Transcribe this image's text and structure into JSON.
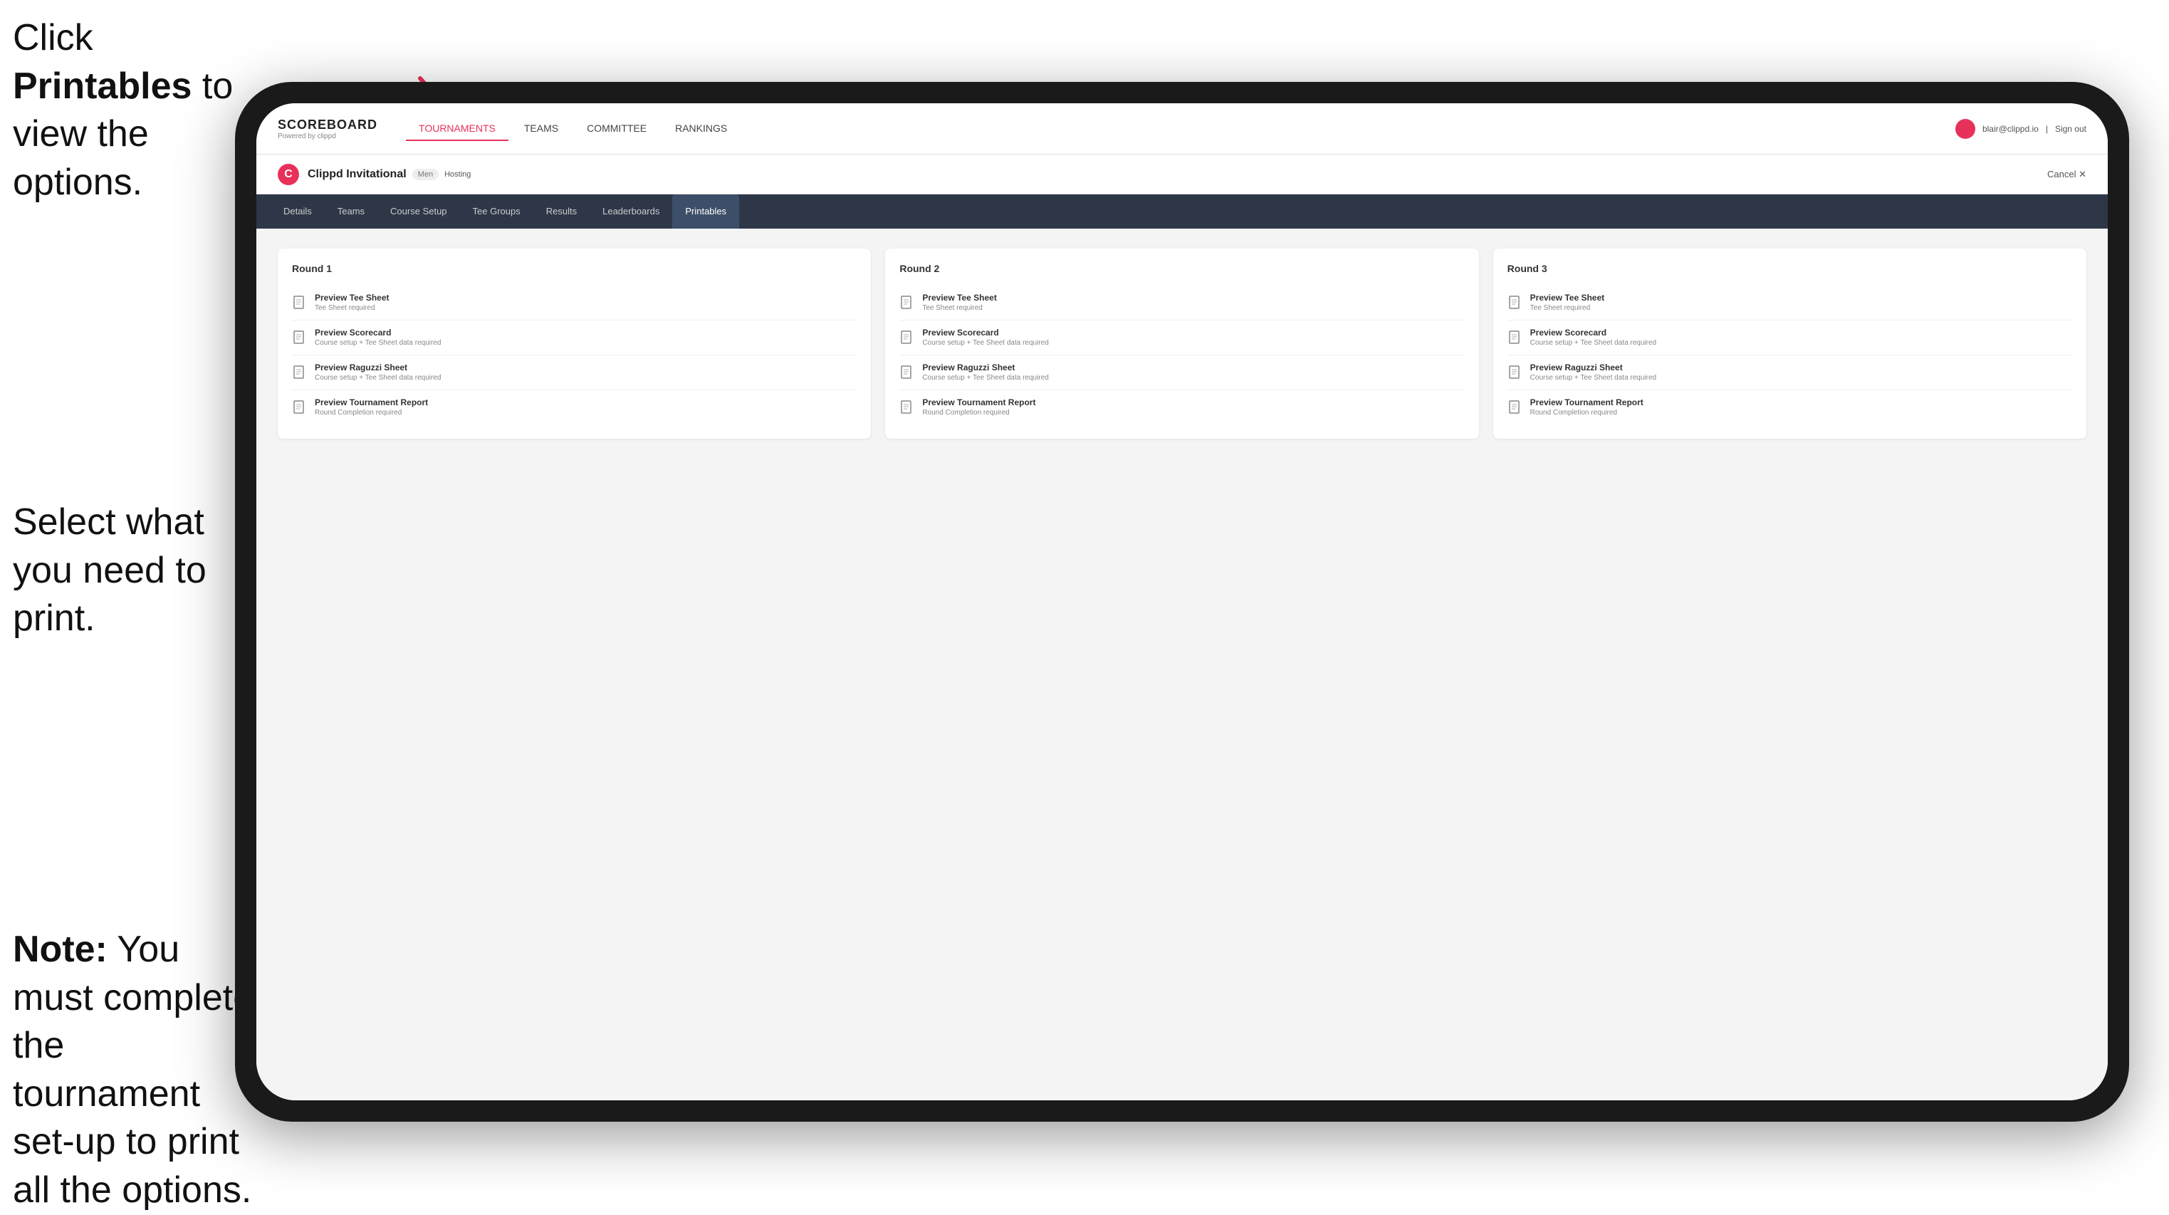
{
  "annotations": {
    "top": {
      "pre": "Click ",
      "bold": "Printables",
      "post": " to view the options."
    },
    "middle": {
      "text": "Select what you need to print."
    },
    "bottom": {
      "pre": "",
      "bold": "Note:",
      "post": " You must complete the tournament set-up to print all the options."
    }
  },
  "topNav": {
    "logo": "SCOREBOARD",
    "logoSub": "Powered by clippd",
    "items": [
      "TOURNAMENTS",
      "TEAMS",
      "COMMITTEE",
      "RANKINGS"
    ],
    "activeItem": "TOURNAMENTS",
    "userEmail": "blair@clippd.io",
    "signOut": "Sign out"
  },
  "tournamentHeader": {
    "logoLetter": "C",
    "name": "Clippd Invitational",
    "badge": "Men",
    "status": "Hosting",
    "cancel": "Cancel ✕"
  },
  "tabs": {
    "items": [
      "Details",
      "Teams",
      "Course Setup",
      "Tee Groups",
      "Results",
      "Leaderboards",
      "Printables"
    ],
    "activeTab": "Printables"
  },
  "rounds": [
    {
      "title": "Round 1",
      "items": [
        {
          "title": "Preview Tee Sheet",
          "sub": "Tee Sheet required"
        },
        {
          "title": "Preview Scorecard",
          "sub": "Course setup + Tee Sheet data required"
        },
        {
          "title": "Preview Raguzzi Sheet",
          "sub": "Course setup + Tee Sheet data required"
        },
        {
          "title": "Preview Tournament Report",
          "sub": "Round Completion required"
        }
      ]
    },
    {
      "title": "Round 2",
      "items": [
        {
          "title": "Preview Tee Sheet",
          "sub": "Tee Sheet required"
        },
        {
          "title": "Preview Scorecard",
          "sub": "Course setup + Tee Sheet data required"
        },
        {
          "title": "Preview Raguzzi Sheet",
          "sub": "Course setup + Tee Sheet data required"
        },
        {
          "title": "Preview Tournament Report",
          "sub": "Round Completion required"
        }
      ]
    },
    {
      "title": "Round 3",
      "items": [
        {
          "title": "Preview Tee Sheet",
          "sub": "Tee Sheet required"
        },
        {
          "title": "Preview Scorecard",
          "sub": "Course setup + Tee Sheet data required"
        },
        {
          "title": "Preview Raguzzi Sheet",
          "sub": "Course setup + Tee Sheet data required"
        },
        {
          "title": "Preview Tournament Report",
          "sub": "Round Completion required"
        }
      ]
    }
  ]
}
